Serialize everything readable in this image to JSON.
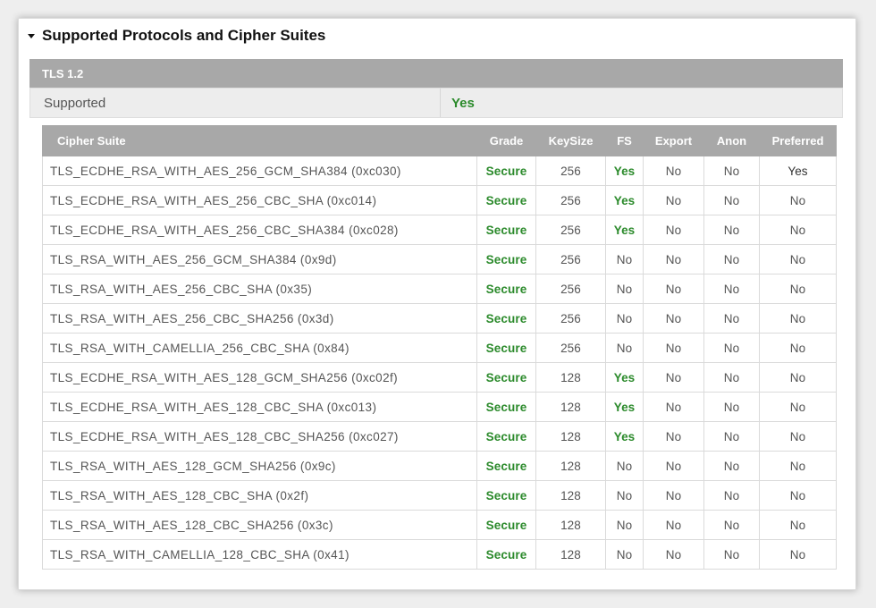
{
  "section": {
    "title": "Supported Protocols and Cipher Suites",
    "icon": "caret-down-icon"
  },
  "protocol": {
    "name": "TLS 1.2",
    "supported_label": "Supported",
    "supported_value": "Yes"
  },
  "table": {
    "headers": [
      "Cipher Suite",
      "Grade",
      "KeySize",
      "FS",
      "Export",
      "Anon",
      "Preferred"
    ],
    "rows": [
      {
        "suite": "TLS_ECDHE_RSA_WITH_AES_256_GCM_SHA384 (0xc030)",
        "grade": "Secure",
        "keysize": "256",
        "fs": "Yes",
        "export": "No",
        "anon": "No",
        "preferred": "Yes"
      },
      {
        "suite": "TLS_ECDHE_RSA_WITH_AES_256_CBC_SHA (0xc014)",
        "grade": "Secure",
        "keysize": "256",
        "fs": "Yes",
        "export": "No",
        "anon": "No",
        "preferred": "No"
      },
      {
        "suite": "TLS_ECDHE_RSA_WITH_AES_256_CBC_SHA384 (0xc028)",
        "grade": "Secure",
        "keysize": "256",
        "fs": "Yes",
        "export": "No",
        "anon": "No",
        "preferred": "No"
      },
      {
        "suite": "TLS_RSA_WITH_AES_256_GCM_SHA384 (0x9d)",
        "grade": "Secure",
        "keysize": "256",
        "fs": "No",
        "export": "No",
        "anon": "No",
        "preferred": "No"
      },
      {
        "suite": "TLS_RSA_WITH_AES_256_CBC_SHA (0x35)",
        "grade": "Secure",
        "keysize": "256",
        "fs": "No",
        "export": "No",
        "anon": "No",
        "preferred": "No"
      },
      {
        "suite": "TLS_RSA_WITH_AES_256_CBC_SHA256 (0x3d)",
        "grade": "Secure",
        "keysize": "256",
        "fs": "No",
        "export": "No",
        "anon": "No",
        "preferred": "No"
      },
      {
        "suite": "TLS_RSA_WITH_CAMELLIA_256_CBC_SHA (0x84)",
        "grade": "Secure",
        "keysize": "256",
        "fs": "No",
        "export": "No",
        "anon": "No",
        "preferred": "No"
      },
      {
        "suite": "TLS_ECDHE_RSA_WITH_AES_128_GCM_SHA256 (0xc02f)",
        "grade": "Secure",
        "keysize": "128",
        "fs": "Yes",
        "export": "No",
        "anon": "No",
        "preferred": "No"
      },
      {
        "suite": "TLS_ECDHE_RSA_WITH_AES_128_CBC_SHA (0xc013)",
        "grade": "Secure",
        "keysize": "128",
        "fs": "Yes",
        "export": "No",
        "anon": "No",
        "preferred": "No"
      },
      {
        "suite": "TLS_ECDHE_RSA_WITH_AES_128_CBC_SHA256 (0xc027)",
        "grade": "Secure",
        "keysize": "128",
        "fs": "Yes",
        "export": "No",
        "anon": "No",
        "preferred": "No"
      },
      {
        "suite": "TLS_RSA_WITH_AES_128_GCM_SHA256 (0x9c)",
        "grade": "Secure",
        "keysize": "128",
        "fs": "No",
        "export": "No",
        "anon": "No",
        "preferred": "No"
      },
      {
        "suite": "TLS_RSA_WITH_AES_128_CBC_SHA (0x2f)",
        "grade": "Secure",
        "keysize": "128",
        "fs": "No",
        "export": "No",
        "anon": "No",
        "preferred": "No"
      },
      {
        "suite": "TLS_RSA_WITH_AES_128_CBC_SHA256 (0x3c)",
        "grade": "Secure",
        "keysize": "128",
        "fs": "No",
        "export": "No",
        "anon": "No",
        "preferred": "No"
      },
      {
        "suite": "TLS_RSA_WITH_CAMELLIA_128_CBC_SHA (0x41)",
        "grade": "Secure",
        "keysize": "128",
        "fs": "No",
        "export": "No",
        "anon": "No",
        "preferred": "No"
      }
    ]
  },
  "colors": {
    "secure_green": "#2b8a2b",
    "header_gray": "#a8a8a8"
  }
}
